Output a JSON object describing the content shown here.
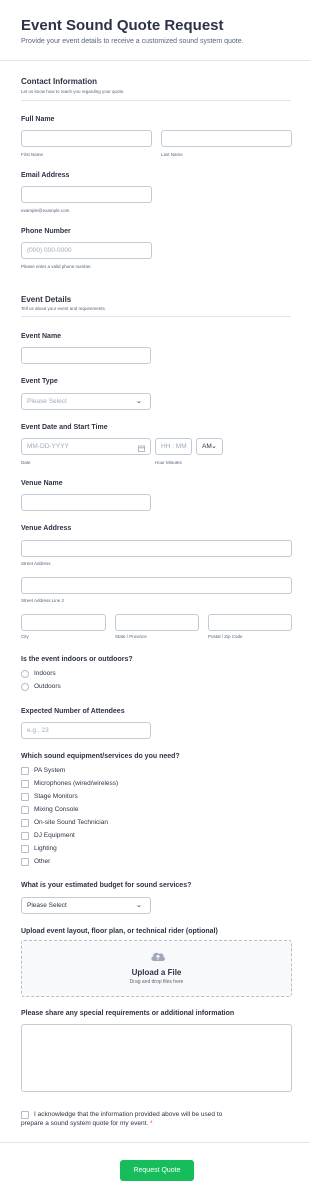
{
  "header": {
    "title": "Event Sound Quote Request",
    "subtitle": "Provide your event details to receive a customized sound system quote."
  },
  "contact": {
    "heading": "Contact Information",
    "subheading": "Let us know how to reach you regarding your quote.",
    "full_name_label": "Full Name",
    "first_name_sub": "First Name",
    "last_name_sub": "Last Name",
    "email_label": "Email Address",
    "email_sub": "example@example.com",
    "phone_label": "Phone Number",
    "phone_placeholder": "(000) 000-0000",
    "phone_sub": "Please enter a valid phone number."
  },
  "event": {
    "heading": "Event Details",
    "subheading": "Tell us about your event and requirements.",
    "name_label": "Event Name",
    "type_label": "Event Type",
    "type_selected": "Please Select",
    "datetime_label": "Event Date and Start Time",
    "date_placeholder": "MM-DD-YYYY",
    "time_placeholder": "HH : MM",
    "ampm_value": "AM",
    "date_sub": "Date",
    "time_sub": "Hour Minutes",
    "venue_name_label": "Venue Name",
    "venue_address_label": "Venue Address",
    "street_sub": "Street Address",
    "street2_sub": "Street Address Line 2",
    "city_sub": "City",
    "state_sub": "State / Province",
    "postal_sub": "Postal / Zip Code",
    "indoor_label": "Is the event indoors or outdoors?",
    "indoor_options": [
      "Indoors",
      "Outdoors"
    ],
    "attendees_label": "Expected Number of Attendees",
    "attendees_placeholder": "e.g., 23",
    "equipment_label": "Which sound equipment/services do you need?",
    "equipment_options": [
      "PA System",
      "Microphones (wired/wireless)",
      "Stage Monitors",
      "Mixing Console",
      "On-site Sound Technician",
      "DJ Equipment",
      "Lighting",
      "Other"
    ],
    "budget_label": "What is your estimated budget for sound services?",
    "budget_selected": "Please Select",
    "upload_label": "Upload event layout, floor plan, or technical rider (optional)",
    "upload_title": "Upload a File",
    "upload_sub": "Drag and drop files here",
    "requirements_label": "Please share any special requirements or additional information",
    "ack_text_line1": "I acknowledge that the information provided above will be used to",
    "ack_text_line2": "prepare a sound system quote for my event.",
    "ack_required": "*"
  },
  "submit_label": "Request Quote",
  "colors": {
    "accent": "#18bd5b",
    "required": "#f23a3c",
    "text": "#2c3345"
  },
  "icons": {
    "calendar": "calendar-icon",
    "upload": "cloud-upload-icon",
    "chevron": "chevron-down-icon"
  }
}
